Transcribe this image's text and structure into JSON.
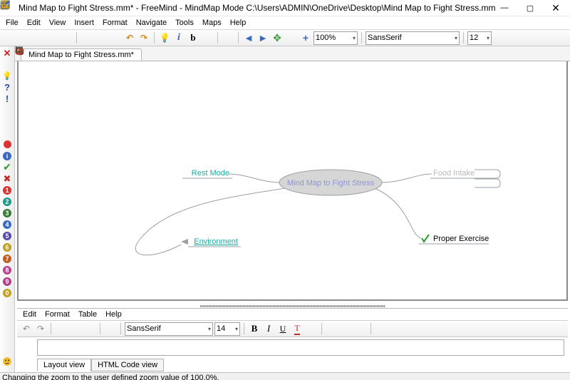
{
  "window": {
    "title": "Mind Map to Fight Stress.mm* - FreeMind - MindMap Mode C:\\Users\\ADMIN\\OneDrive\\Desktop\\Mind Map to Fight Stress.mm",
    "controls": {
      "min": "—",
      "max": "▢",
      "close": "✕"
    }
  },
  "menubar": [
    "File",
    "Edit",
    "View",
    "Insert",
    "Format",
    "Navigate",
    "Tools",
    "Maps",
    "Help"
  ],
  "toolbar": {
    "zoom": "100%",
    "font": "SansSerif",
    "size": "12"
  },
  "tab": "Mind Map to Fight Stress.mm*",
  "map": {
    "root": "Mind Map to Fight Stress",
    "left": [
      {
        "label": "Rest Mode"
      },
      {
        "label": "Environment",
        "icon": "arrow"
      }
    ],
    "right": [
      {
        "label": "Food Intake"
      },
      {
        "label": "Proper Exercise",
        "icon": "check"
      }
    ]
  },
  "editor": {
    "menu": [
      "Edit",
      "Format",
      "Table",
      "Help"
    ],
    "font": "SansSerif",
    "size": "14",
    "tabs": [
      "Layout view",
      "HTML Code view"
    ]
  },
  "status": "Changing the zoom to the user defined zoom value of 100.0%."
}
